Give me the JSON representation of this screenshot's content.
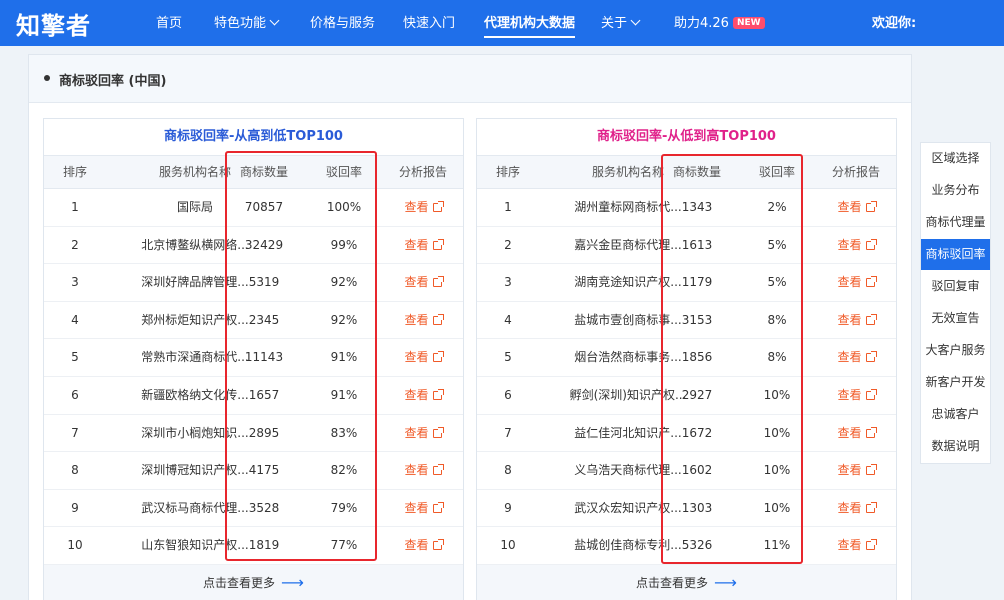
{
  "nav": {
    "logo": "知擎者",
    "items": [
      {
        "label": "首页"
      },
      {
        "label": "特色功能"
      },
      {
        "label": "价格与服务"
      },
      {
        "label": "快速入门"
      },
      {
        "label": "代理机构大数据"
      },
      {
        "label": "关于"
      },
      {
        "label": "助力4.26"
      }
    ],
    "badge": "NEW",
    "welcome": "欢迎你:"
  },
  "panel": {
    "title": "商标驳回率 (中国)"
  },
  "left_table": {
    "title": "商标驳回率-从高到低TOP100",
    "title_color": "#2a5bd7",
    "headers": [
      "排序",
      "服务机构名称",
      "商标数量",
      "驳回率",
      "分析报告"
    ],
    "rows": [
      {
        "rank": "1",
        "name": "国际局",
        "count": "70857",
        "rate": "100%",
        "action": "查看"
      },
      {
        "rank": "2",
        "name": "北京博鳌纵横网络...",
        "count": "32429",
        "rate": "99%",
        "action": "查看"
      },
      {
        "rank": "3",
        "name": "深圳好牌品牌管理...",
        "count": "5319",
        "rate": "92%",
        "action": "查看"
      },
      {
        "rank": "4",
        "name": "郑州标炬知识产权...",
        "count": "2345",
        "rate": "92%",
        "action": "查看"
      },
      {
        "rank": "5",
        "name": "常熟市深通商标代...",
        "count": "11143",
        "rate": "91%",
        "action": "查看"
      },
      {
        "rank": "6",
        "name": "新疆欧格纳文化传...",
        "count": "1657",
        "rate": "91%",
        "action": "查看"
      },
      {
        "rank": "7",
        "name": "深圳市小榈炮知识...",
        "count": "2895",
        "rate": "83%",
        "action": "查看"
      },
      {
        "rank": "8",
        "name": "深圳博冠知识产权...",
        "count": "4175",
        "rate": "82%",
        "action": "查看"
      },
      {
        "rank": "9",
        "name": "武汉标马商标代理...",
        "count": "3528",
        "rate": "79%",
        "action": "查看"
      },
      {
        "rank": "10",
        "name": "山东智狼知识产权...",
        "count": "1819",
        "rate": "77%",
        "action": "查看"
      }
    ],
    "more": "点击查看更多"
  },
  "right_table": {
    "title": "商标驳回率-从低到高TOP100",
    "title_color": "#e0218a",
    "headers": [
      "排序",
      "服务机构名称",
      "商标数量",
      "驳回率",
      "分析报告"
    ],
    "rows": [
      {
        "rank": "1",
        "name": "湖州童标网商标代...",
        "count": "1343",
        "rate": "2%",
        "action": "查看"
      },
      {
        "rank": "2",
        "name": "嘉兴金臣商标代理...",
        "count": "1613",
        "rate": "5%",
        "action": "查看"
      },
      {
        "rank": "3",
        "name": "湖南竞途知识产权...",
        "count": "1179",
        "rate": "5%",
        "action": "查看"
      },
      {
        "rank": "4",
        "name": "盐城市壹创商标事...",
        "count": "3153",
        "rate": "8%",
        "action": "查看"
      },
      {
        "rank": "5",
        "name": "烟台浩然商标事务...",
        "count": "1856",
        "rate": "8%",
        "action": "查看"
      },
      {
        "rank": "6",
        "name": "孵剑(深圳)知识产权...",
        "count": "2927",
        "rate": "10%",
        "action": "查看"
      },
      {
        "rank": "7",
        "name": "益仁佳河北知识产...",
        "count": "1672",
        "rate": "10%",
        "action": "查看"
      },
      {
        "rank": "8",
        "name": "义乌浩天商标代理...",
        "count": "1602",
        "rate": "10%",
        "action": "查看"
      },
      {
        "rank": "9",
        "name": "武汉众宏知识产权...",
        "count": "1303",
        "rate": "10%",
        "action": "查看"
      },
      {
        "rank": "10",
        "name": "盐城创佳商标专利...",
        "count": "5326",
        "rate": "11%",
        "action": "查看"
      }
    ],
    "more": "点击查看更多"
  },
  "side_menu": {
    "items": [
      "区域选择",
      "业务分布",
      "商标代理量",
      "商标驳回率",
      "驳回复审",
      "无效宣告",
      "大客户服务",
      "新客户开发",
      "忠诚客户",
      "数据说明"
    ],
    "active": "商标驳回率"
  },
  "colors": {
    "nav_bg": "#1f6fea",
    "highlight_box": "#e8262d",
    "link": "#f05a28"
  }
}
